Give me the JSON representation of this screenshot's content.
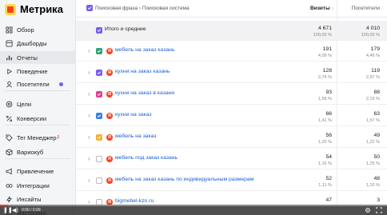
{
  "app": {
    "logo_text": "Метрика",
    "brand_color": "#ffdb4d",
    "accent_color": "#7b5cf5"
  },
  "sidebar": {
    "items": [
      {
        "label": "Обзор",
        "icon": "grid-icon"
      },
      {
        "label": "Дашборды",
        "icon": "dashboard-icon"
      },
      {
        "label": "Отчеты",
        "icon": "reports-icon",
        "active": true
      },
      {
        "label": "Поведение",
        "icon": "play-icon"
      },
      {
        "label": "Посетители",
        "icon": "user-icon",
        "badge": true
      },
      {
        "label": "Цели",
        "icon": "target-icon"
      },
      {
        "label": "Конверсии",
        "icon": "percent-icon"
      },
      {
        "label": "Тег Менеджер",
        "icon": "tag-icon",
        "sup": "β"
      },
      {
        "label": "Вариокуб",
        "icon": "cube-icon"
      },
      {
        "label": "Привлечение",
        "icon": "megaphone-icon"
      },
      {
        "label": "Интеграции",
        "icon": "integration-icon"
      },
      {
        "label": "Инсайты",
        "icon": "lightning-icon"
      },
      {
        "label": "Настройки",
        "icon": "gear-icon"
      }
    ]
  },
  "table": {
    "header": {
      "dimensions": "Поисковая фраза › Поисковая система",
      "visits": "Визиты",
      "visits_sort": "↓",
      "visitors": "Посетители"
    },
    "total": {
      "label": "Итого и средние",
      "visits": "4 671",
      "visits_pct": "100,00 %",
      "visitors": "4 010",
      "visitors_pct": "100,00 %"
    },
    "rows": [
      {
        "label": "мебель на заказ казань",
        "checkbox_color": "#2fa37a",
        "visits": "191",
        "visits_pct": "4,09 %",
        "visitors": "179",
        "visitors_pct": "4,46 %"
      },
      {
        "label": "кухни на заказ казань",
        "checkbox_color": "#7b5cf5",
        "visits": "128",
        "visits_pct": "2,74 %",
        "visitors": "119",
        "visitors_pct": "2,97 %"
      },
      {
        "label": "кухни на заказ в казани",
        "checkbox_color": "#e0408a",
        "visits": "93",
        "visits_pct": "1,99 %",
        "visitors": "88",
        "visitors_pct": "2,19 %"
      },
      {
        "label": "кухни на заказ",
        "checkbox_color": "#3b82e6",
        "visits": "66",
        "visits_pct": "1,41 %",
        "visitors": "63",
        "visitors_pct": "1,57 %"
      },
      {
        "label": "мебель на заказ",
        "checkbox_color": "#f2b233",
        "visits": "56",
        "visits_pct": "1,20 %",
        "visitors": "49",
        "visitors_pct": "1,22 %"
      },
      {
        "label": "мебель под заказ казань",
        "checkbox_color": null,
        "visits": "54",
        "visits_pct": "1,16 %",
        "visitors": "50",
        "visitors_pct": "1,25 %"
      },
      {
        "label": "мебель на заказ казань по индивидуальным размерам",
        "checkbox_color": null,
        "visits": "52",
        "visits_pct": "1,11 %",
        "visitors": "48",
        "visitors_pct": "1,20 %"
      },
      {
        "label": "bigmebel-kzn.ru",
        "checkbox_color": null,
        "visits": "47",
        "visits_pct": "",
        "visitors": "3",
        "visitors_pct": ""
      }
    ]
  },
  "player": {
    "time": "0:00 / 0:09",
    "progress": 0.02
  }
}
